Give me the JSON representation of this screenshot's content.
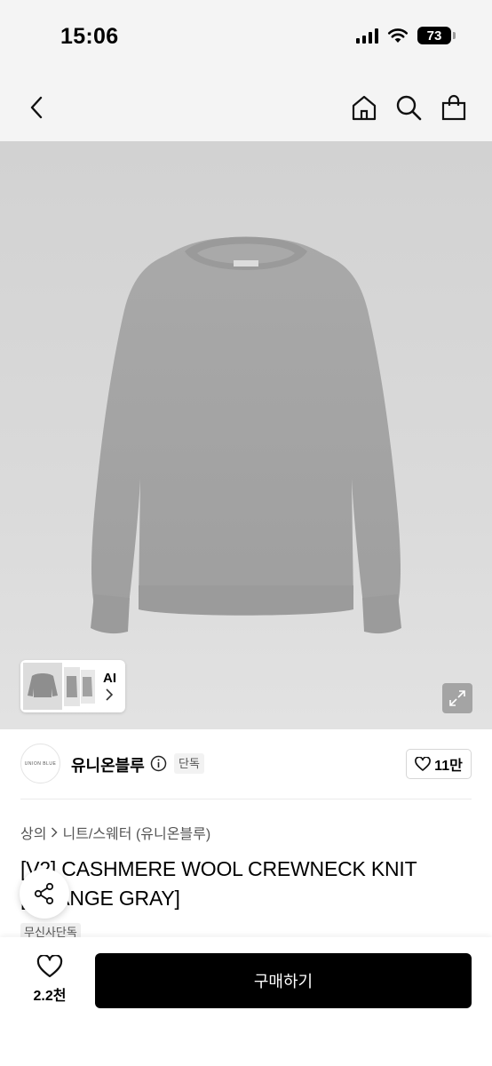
{
  "status_bar": {
    "time": "15:06",
    "battery": "73"
  },
  "nav": {
    "back_icon": "chevron-left-icon",
    "home_icon": "home-icon",
    "search_icon": "search-icon",
    "cart_icon": "shopping-bag-icon"
  },
  "gallery": {
    "ai_label": "AI"
  },
  "brand": {
    "logo_text": "UNION BLUE",
    "name": "유니온블루",
    "exclusive_badge": "단독",
    "like_count": "11만"
  },
  "breadcrumb": {
    "category": "상의",
    "subcategory": "니트/스웨터 (유니온블루)"
  },
  "product": {
    "title": "[V2] CASHMERE WOOL CREWNECK KNIT [ORANGE GRAY]",
    "tag": "무신사단독"
  },
  "bottom_bar": {
    "wish_count": "2.2천",
    "buy_label": "구매하기"
  }
}
